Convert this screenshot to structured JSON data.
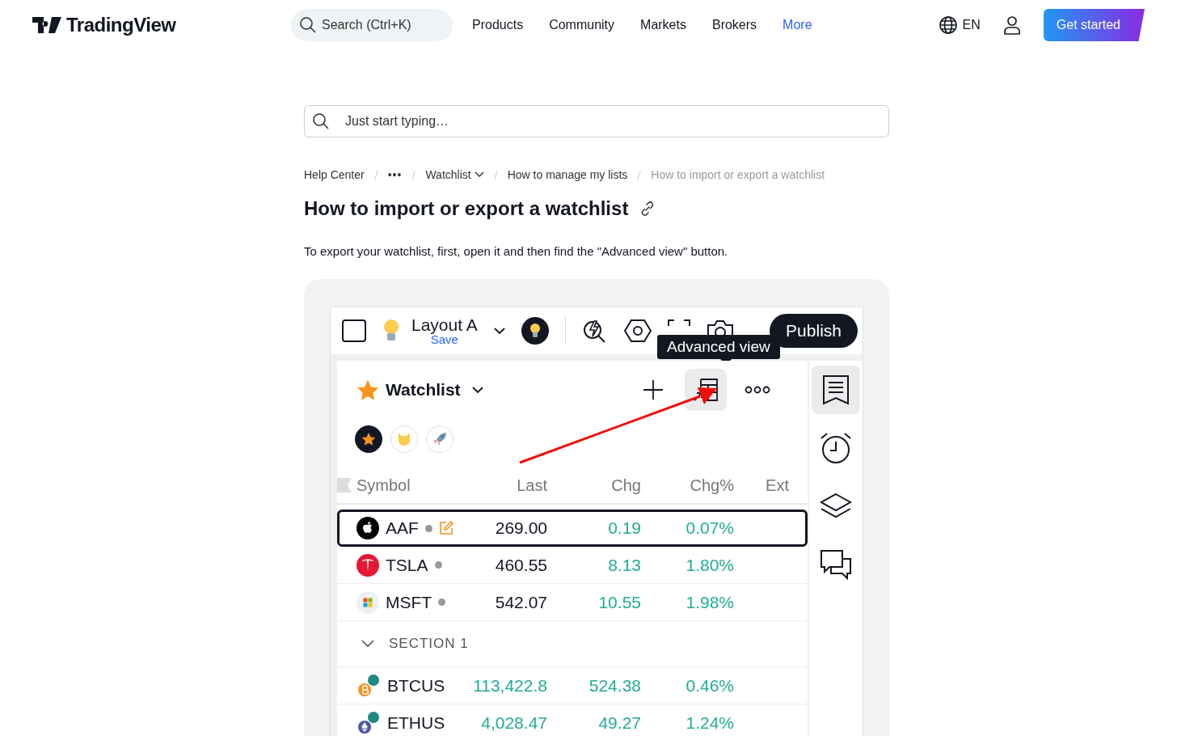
{
  "header": {
    "logo": "TradingView",
    "search": {
      "placeholder": "Search (Ctrl+K)"
    },
    "links": [
      {
        "label": "Products",
        "selected": false
      },
      {
        "label": "Community",
        "selected": false
      },
      {
        "label": "Markets",
        "selected": false
      },
      {
        "label": "Brokers",
        "selected": false
      },
      {
        "label": "More",
        "selected": true
      }
    ],
    "language": "EN",
    "cta": "Get started"
  },
  "help_search": {
    "placeholder": "Just start typing…"
  },
  "breadcrumb": [
    {
      "label": "Help Center",
      "kind": "link"
    },
    {
      "label": "•••",
      "kind": "more"
    },
    {
      "label": "Watchlist",
      "kind": "dropdown"
    },
    {
      "label": "How to manage my lists",
      "kind": "link"
    },
    {
      "label": "How to import or export a watchlist",
      "kind": "current"
    }
  ],
  "article": {
    "title": "How to import or export a watchlist",
    "paragraph": "To export your watchlist, first, open it and then find the \"Advanced view\" button."
  },
  "screenshot": {
    "layout_name": "Layout A",
    "save": "Save",
    "publish": "Publish",
    "tooltip": "Advanced view",
    "watchlist_title": "Watchlist",
    "flags": [
      {
        "kind": "star",
        "selected": true
      },
      {
        "kind": "cat",
        "selected": false
      },
      {
        "kind": "rocket",
        "selected": false
      }
    ],
    "columns": [
      "Symbol",
      "Last",
      "Chg",
      "Chg%",
      "Ext"
    ],
    "rows": [
      {
        "kind": "apple",
        "symbol": "AAF",
        "dot": true,
        "last": "269.00",
        "last_up": false,
        "chg": "0.19",
        "chg_pct": "0.07%",
        "selected": true
      },
      {
        "kind": "tesla",
        "symbol": "TSLA",
        "dot": true,
        "last": "460.55",
        "last_up": false,
        "chg": "8.13",
        "chg_pct": "1.80%",
        "selected": false
      },
      {
        "kind": "windows",
        "symbol": "MSFT",
        "dot": true,
        "last": "542.07",
        "last_up": false,
        "chg": "10.55",
        "chg_pct": "1.98%",
        "selected": false
      },
      {
        "kind": "section",
        "label": "SECTION 1",
        "expanded": true
      },
      {
        "kind": "bitcoin",
        "symbol": "BTCUS",
        "dot": false,
        "last": "113,422.8",
        "last_up": true,
        "chg": "524.38",
        "chg_pct": "0.46%",
        "selected": false
      },
      {
        "kind": "ether",
        "symbol": "ETHUS",
        "dot": false,
        "last": "4,028.47",
        "last_up": true,
        "chg": "49.27",
        "chg_pct": "1.24%",
        "selected": false
      }
    ],
    "sidebar": [
      {
        "kind": "watchlist",
        "selected": true
      },
      {
        "kind": "alerts",
        "selected": false
      },
      {
        "kind": "layers",
        "selected": false
      },
      {
        "kind": "chat",
        "selected": false
      }
    ]
  }
}
